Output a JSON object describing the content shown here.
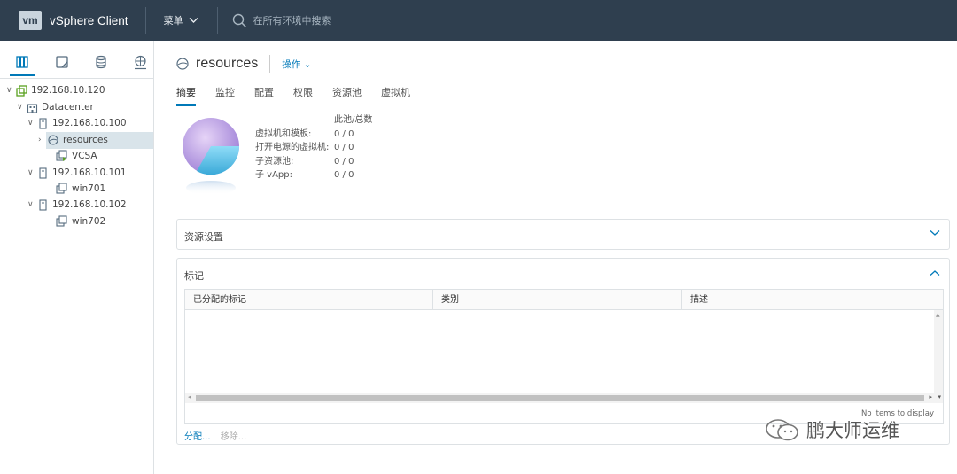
{
  "header": {
    "logo": "vm",
    "app_title": "vSphere Client",
    "menu_label": "菜单",
    "search_placeholder": "在所有环境中搜索"
  },
  "sidebar": {
    "tabs": [
      "hosts-and-clusters-icon",
      "vms-and-templates-icon",
      "storage-icon",
      "networking-icon"
    ],
    "tree": [
      {
        "label": "192.168.10.120",
        "icon": "vcenter-icon",
        "expanded": true
      },
      {
        "label": "Datacenter",
        "icon": "datacenter-icon",
        "expanded": true
      },
      {
        "label": "192.168.10.100",
        "icon": "host-icon",
        "expanded": true
      },
      {
        "label": "resources",
        "icon": "resource-pool-icon",
        "expanded": false,
        "selected": true
      },
      {
        "label": "VCSA",
        "icon": "vm-on-icon"
      },
      {
        "label": "192.168.10.101",
        "icon": "host-icon",
        "expanded": true
      },
      {
        "label": "win701",
        "icon": "vm-icon"
      },
      {
        "label": "192.168.10.102",
        "icon": "host-icon",
        "expanded": true
      },
      {
        "label": "win702",
        "icon": "vm-icon"
      }
    ]
  },
  "main": {
    "title": "resources",
    "actions_label": "操作",
    "tabs": [
      "摘要",
      "监控",
      "配置",
      "权限",
      "资源池",
      "虚拟机"
    ],
    "active_tab": "摘要",
    "stats_header": "此池/总数",
    "stats": [
      {
        "label": "虚拟机和模板:",
        "value": "0 / 0"
      },
      {
        "label": "打开电源的虚拟机:",
        "value": "0 / 0"
      },
      {
        "label": "子资源池:",
        "value": "0 / 0"
      },
      {
        "label": "子 vApp:",
        "value": "0 / 0"
      }
    ],
    "resource_settings_title": "资源设置",
    "tags_title": "标记",
    "tags_columns": [
      "已分配的标记",
      "类别",
      "描述"
    ],
    "tags_empty": "No items to display",
    "assign_label": "分配...",
    "remove_label": "移除..."
  },
  "watermark": "鹏大师运维",
  "colors": {
    "header_bg": "#2f3f4f",
    "accent": "#0079b8",
    "selected_bg": "#d9e4ea"
  }
}
